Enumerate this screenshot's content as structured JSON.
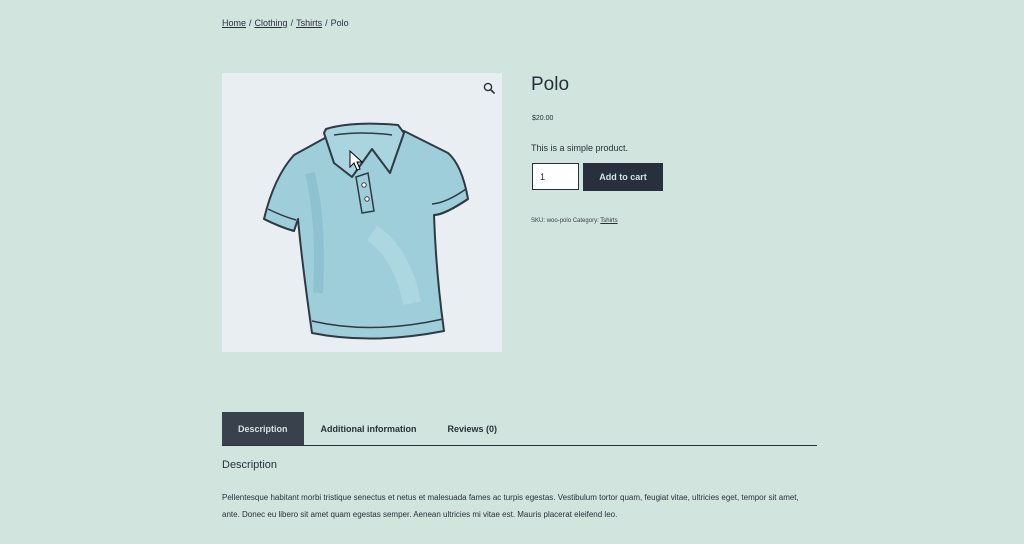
{
  "breadcrumb": {
    "items": [
      "Home",
      "Clothing",
      "Tshirts"
    ],
    "current": "Polo",
    "separator": "/"
  },
  "gallery": {
    "zoom_icon": "magnifier-icon",
    "image": "blue-polo-shirt-illustration"
  },
  "product": {
    "title": "Polo",
    "price": "$20.00",
    "short_description": "This is a simple product.",
    "quantity": "1",
    "add_to_cart_label": "Add to cart",
    "sku_label": "SKU:",
    "sku": "woo-polo",
    "category_label": "Category:",
    "category": "Tshirts"
  },
  "tabs": {
    "items": [
      "Description",
      "Additional information",
      "Reviews (0)"
    ],
    "active": "Description"
  },
  "panel": {
    "title": "Description",
    "text": "Pellentesque habitant morbi tristique senectus et netus et malesuada fames ac turpis egestas. Vestibulum tortor quam, feugiat vitae, ultricies eget, tempor sit amet, ante. Donec eu libero sit amet quam egestas semper. Aenean ultricies mi vitae est. Mauris placerat eleifend leo."
  },
  "colors": {
    "background": "#d1e4dd",
    "dark": "#28303d",
    "image_bg": "#e9eef2",
    "shirt": "#9fcedb"
  }
}
